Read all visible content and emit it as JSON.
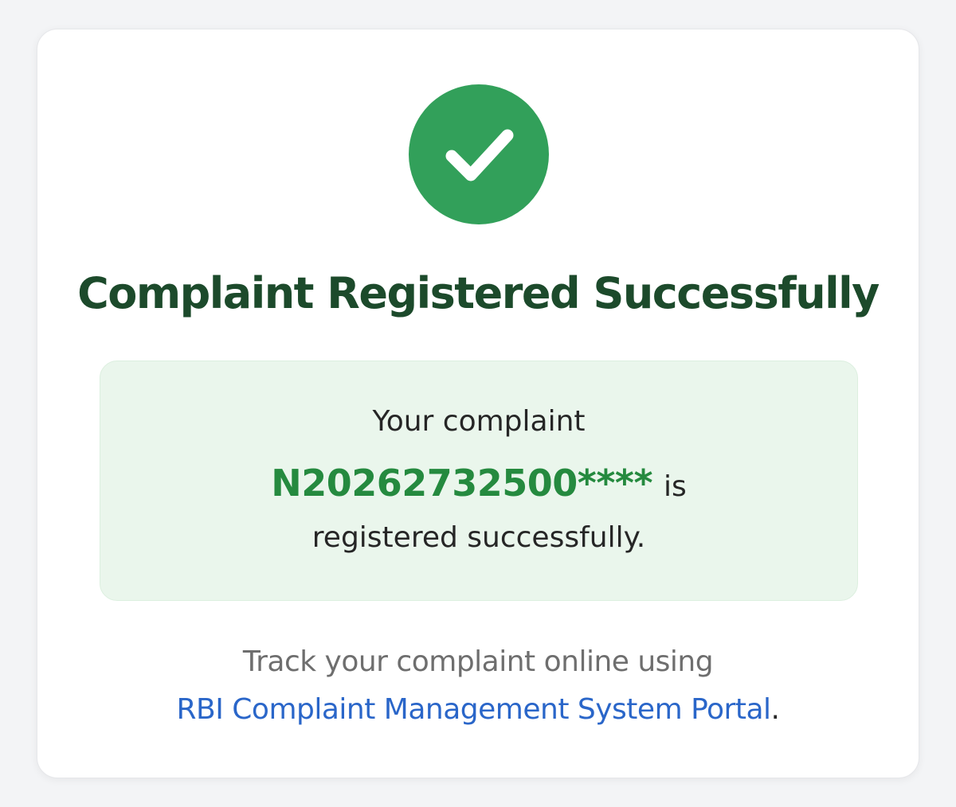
{
  "icon": {
    "name": "checkmark-icon",
    "background_color": "#32a05a",
    "check_color": "#ffffff"
  },
  "title": "Complaint Registered Successfully",
  "message": {
    "line1": "Your complaint",
    "complaint_id": "N20262732500****",
    "is_text": "is",
    "line3": "registered successfully."
  },
  "tracking": {
    "text": "Track your complaint online using",
    "link_label": "RBI Complaint Management System Portal",
    "trailing": "."
  },
  "colors": {
    "title": "#1c4a2b",
    "complaint_id": "#258a3f",
    "link": "#2a66c9",
    "message_box_bg": "#eaf6ec"
  }
}
